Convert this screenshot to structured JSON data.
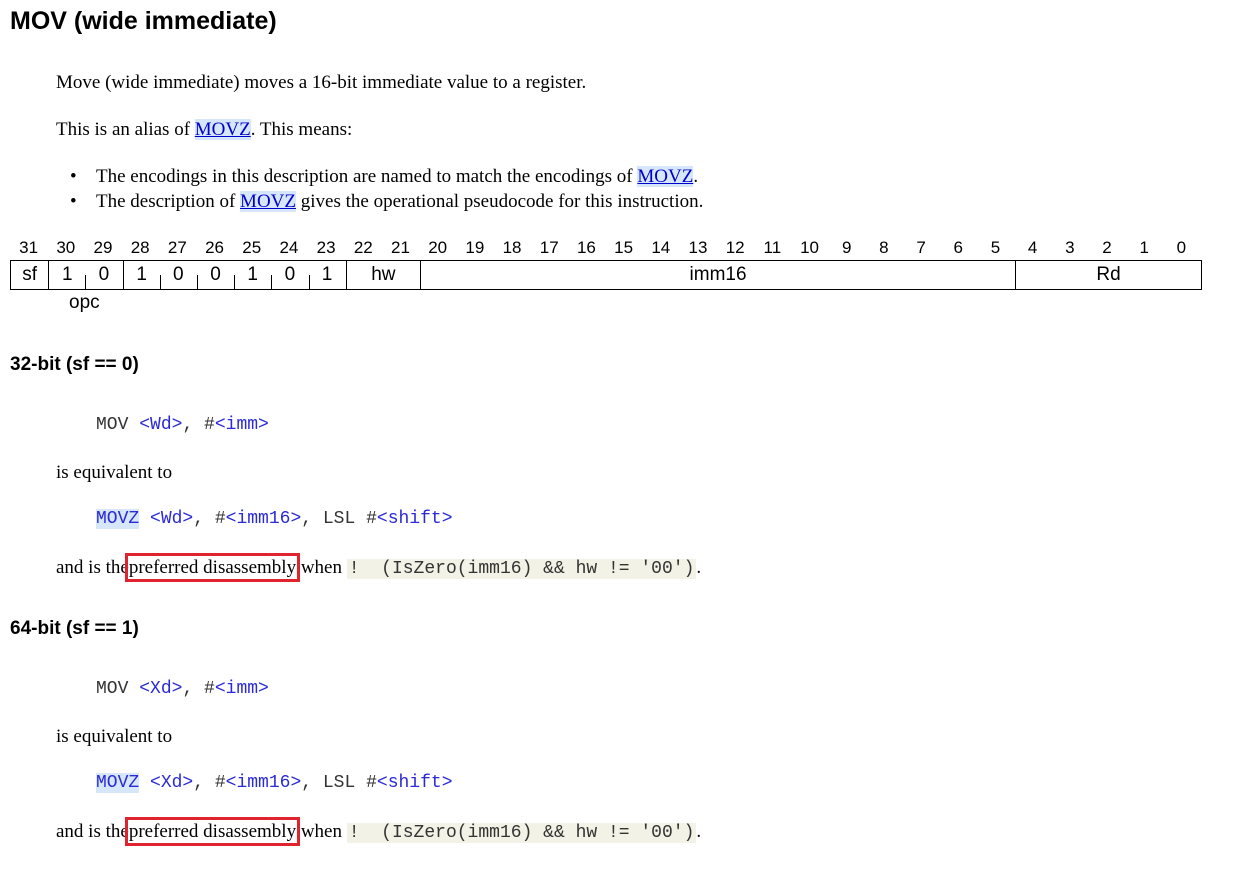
{
  "title": "MOV (wide immediate)",
  "intro": {
    "summary": "Move (wide immediate) moves a 16-bit immediate value to a register.",
    "alias_prefix": "This is an alias of ",
    "alias_link": "MOVZ",
    "alias_suffix": ". This means:",
    "bullets": [
      {
        "prefix": "The encodings in this description are named to match the encodings of ",
        "link": "MOVZ",
        "suffix": "."
      },
      {
        "prefix": "The description of ",
        "link": "MOVZ",
        "suffix": " gives the operational pseudocode for this instruction."
      }
    ]
  },
  "encoding": {
    "bit_numbers": [
      "31",
      "30",
      "29",
      "28",
      "27",
      "26",
      "25",
      "24",
      "23",
      "22",
      "21",
      "20",
      "19",
      "18",
      "17",
      "16",
      "15",
      "14",
      "13",
      "12",
      "11",
      "10",
      "9",
      "8",
      "7",
      "6",
      "5",
      "4",
      "3",
      "2",
      "1",
      "0"
    ],
    "fields": [
      {
        "label": "sf"
      },
      {
        "label": "1"
      },
      {
        "label": "0"
      },
      {
        "label": "1"
      },
      {
        "label": "0"
      },
      {
        "label": "0"
      },
      {
        "label": "1"
      },
      {
        "label": "0"
      },
      {
        "label": "1"
      },
      {
        "label": "hw"
      },
      {
        "label": "imm16"
      },
      {
        "label": "Rd"
      }
    ],
    "opc_label": "opc"
  },
  "variants": [
    {
      "heading": "32-bit (sf == 0)",
      "syntax_mnemonic": "MOV",
      "syntax_op1": "<Wd>",
      "syntax_sep": ", #",
      "syntax_op2": "<imm>",
      "equiv_text": "is equivalent to",
      "alias_mnemonic": "MOVZ",
      "alias_op1": "<Wd>",
      "alias_sep1": ", #",
      "alias_op2": "<imm16>",
      "alias_sep2": ", LSL #",
      "alias_op3": "<shift>",
      "pref_prefix": "and is the",
      "pref_highlight": "preferred disassembly",
      "pref_when": "when",
      "pref_condition": "!  (IsZero(imm16) && hw != '00')",
      "pref_suffix": "."
    },
    {
      "heading": "64-bit (sf == 1)",
      "syntax_mnemonic": "MOV",
      "syntax_op1": "<Xd>",
      "syntax_sep": ", #",
      "syntax_op2": "<imm>",
      "equiv_text": "is equivalent to",
      "alias_mnemonic": "MOVZ",
      "alias_op1": "<Xd>",
      "alias_sep1": ", #",
      "alias_op2": "<imm16>",
      "alias_sep2": ", LSL #",
      "alias_op3": "<shift>",
      "pref_prefix": "and is the",
      "pref_highlight": "preferred disassembly",
      "pref_when": "when",
      "pref_condition": "!  (IsZero(imm16) && hw != '00')",
      "pref_suffix": "."
    }
  ],
  "colors": {
    "link": "#0000cc",
    "link_bg": "#d6e6fb",
    "highlight_box": "#e0242f",
    "pseudocode_bg": "#f2f2e6"
  }
}
